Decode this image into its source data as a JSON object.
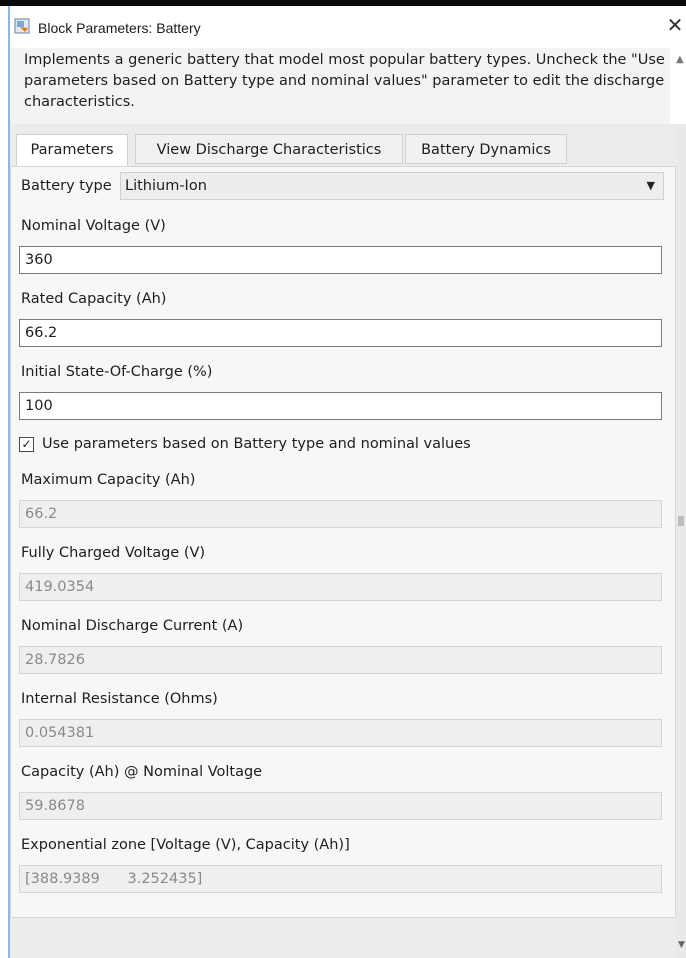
{
  "window": {
    "title": "Block Parameters: Battery",
    "close_glyph": "✕"
  },
  "description": "Implements a generic battery that model most popular battery types. Uncheck the \"Use parameters based on Battery type and nominal values\" parameter to edit the discharge characteristics.",
  "tabs": [
    {
      "label": "Parameters",
      "active": true
    },
    {
      "label": "View Discharge Characteristics",
      "active": false
    },
    {
      "label": "Battery Dynamics",
      "active": false
    }
  ],
  "battery_type": {
    "label": "Battery type",
    "value": "Lithium-Ion"
  },
  "editable_fields": [
    {
      "label": "Nominal Voltage (V)",
      "value": "360"
    },
    {
      "label": "Rated Capacity (Ah)",
      "value": "66.2"
    },
    {
      "label": "Initial State-Of-Charge (%)",
      "value": "100"
    }
  ],
  "use_defaults": {
    "label": "Use parameters based on Battery type and nominal values",
    "checked": true
  },
  "readonly_fields": [
    {
      "label": "Maximum Capacity (Ah)",
      "value": "66.2"
    },
    {
      "label": "Fully Charged Voltage (V)",
      "value": "419.0354"
    },
    {
      "label": "Nominal Discharge Current (A)",
      "value": "28.7826"
    },
    {
      "label": "Internal Resistance (Ohms)",
      "value": "0.054381"
    },
    {
      "label": "Capacity (Ah) @ Nominal Voltage",
      "value": "59.8678"
    },
    {
      "label": "Exponential zone [Voltage (V), Capacity (Ah)]",
      "value": "[388.9389      3.252435]"
    }
  ],
  "icons": {
    "window": "simulink-block-icon",
    "close": "close-icon",
    "dropdown": "chevron-down-icon",
    "checkbox": "checkmark-icon"
  },
  "colors": {
    "panel": "#f7f7f7",
    "readonly_text": "#8a8a8a",
    "window_edge": "#8fb7e0"
  }
}
